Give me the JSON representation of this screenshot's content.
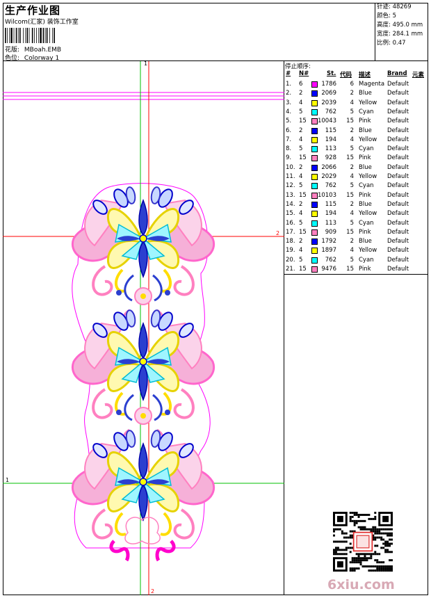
{
  "header": {
    "title": "生产作业图",
    "subtitle": "Wilcom(汇家) 装饰工作室",
    "design_label": "花版:",
    "design_value": "MBoah.EMB",
    "colorway_label": "色位:",
    "colorway_value": "Colorway 1"
  },
  "specs": [
    {
      "label": "针迹:",
      "value": "48269"
    },
    {
      "label": "颜色:",
      "value": "5"
    },
    {
      "label": "高度:",
      "value": "495.0 mm"
    },
    {
      "label": "宽度:",
      "value": "284.1 mm"
    },
    {
      "label": "比例:",
      "value": "0.47"
    }
  ],
  "stop_sequence": {
    "title": "停止顺序:",
    "columns": [
      "#",
      "N#",
      "St.",
      "代码",
      "描述",
      "Brand",
      "元素"
    ],
    "rows": [
      {
        "idx": "1.",
        "n": "6",
        "color": "#ff00ff",
        "st": "1786",
        "code": "6",
        "desc": "Magenta",
        "brand": "Default"
      },
      {
        "idx": "2.",
        "n": "2",
        "color": "#0000ff",
        "st": "2069",
        "code": "2",
        "desc": "Blue",
        "brand": "Default"
      },
      {
        "idx": "3.",
        "n": "4",
        "color": "#ffff00",
        "st": "2039",
        "code": "4",
        "desc": "Yellow",
        "brand": "Default"
      },
      {
        "idx": "4.",
        "n": "5",
        "color": "#00ffff",
        "st": "762",
        "code": "5",
        "desc": "Cyan",
        "brand": "Default"
      },
      {
        "idx": "5.",
        "n": "15",
        "color": "#ff80c0",
        "st": "10043",
        "code": "15",
        "desc": "Pink",
        "brand": "Default"
      },
      {
        "idx": "6.",
        "n": "2",
        "color": "#0000ff",
        "st": "115",
        "code": "2",
        "desc": "Blue",
        "brand": "Default"
      },
      {
        "idx": "7.",
        "n": "4",
        "color": "#ffff00",
        "st": "194",
        "code": "4",
        "desc": "Yellow",
        "brand": "Default"
      },
      {
        "idx": "8.",
        "n": "5",
        "color": "#00ffff",
        "st": "113",
        "code": "5",
        "desc": "Cyan",
        "brand": "Default"
      },
      {
        "idx": "9.",
        "n": "15",
        "color": "#ff80c0",
        "st": "928",
        "code": "15",
        "desc": "Pink",
        "brand": "Default"
      },
      {
        "idx": "10.",
        "n": "2",
        "color": "#0000ff",
        "st": "2066",
        "code": "2",
        "desc": "Blue",
        "brand": "Default"
      },
      {
        "idx": "11.",
        "n": "4",
        "color": "#ffff00",
        "st": "2029",
        "code": "4",
        "desc": "Yellow",
        "brand": "Default"
      },
      {
        "idx": "12.",
        "n": "5",
        "color": "#00ffff",
        "st": "762",
        "code": "5",
        "desc": "Cyan",
        "brand": "Default"
      },
      {
        "idx": "13.",
        "n": "15",
        "color": "#ff80c0",
        "st": "10103",
        "code": "15",
        "desc": "Pink",
        "brand": "Default"
      },
      {
        "idx": "14.",
        "n": "2",
        "color": "#0000ff",
        "st": "115",
        "code": "2",
        "desc": "Blue",
        "brand": "Default"
      },
      {
        "idx": "15.",
        "n": "4",
        "color": "#ffff00",
        "st": "194",
        "code": "4",
        "desc": "Yellow",
        "brand": "Default"
      },
      {
        "idx": "16.",
        "n": "5",
        "color": "#00ffff",
        "st": "113",
        "code": "5",
        "desc": "Cyan",
        "brand": "Default"
      },
      {
        "idx": "17.",
        "n": "15",
        "color": "#ff80c0",
        "st": "909",
        "code": "15",
        "desc": "Pink",
        "brand": "Default"
      },
      {
        "idx": "18.",
        "n": "2",
        "color": "#0000ff",
        "st": "1792",
        "code": "2",
        "desc": "Blue",
        "brand": "Default"
      },
      {
        "idx": "19.",
        "n": "4",
        "color": "#ffff00",
        "st": "1897",
        "code": "4",
        "desc": "Yellow",
        "brand": "Default"
      },
      {
        "idx": "20.",
        "n": "5",
        "color": "#00ffff",
        "st": "762",
        "code": "5",
        "desc": "Cyan",
        "brand": "Default"
      },
      {
        "idx": "21.",
        "n": "15",
        "color": "#ff80c0",
        "st": "9476",
        "code": "15",
        "desc": "Pink",
        "brand": "Default"
      }
    ]
  },
  "guides": {
    "label_1": "1",
    "label_2": "2"
  },
  "watermark": "6xiu.com"
}
